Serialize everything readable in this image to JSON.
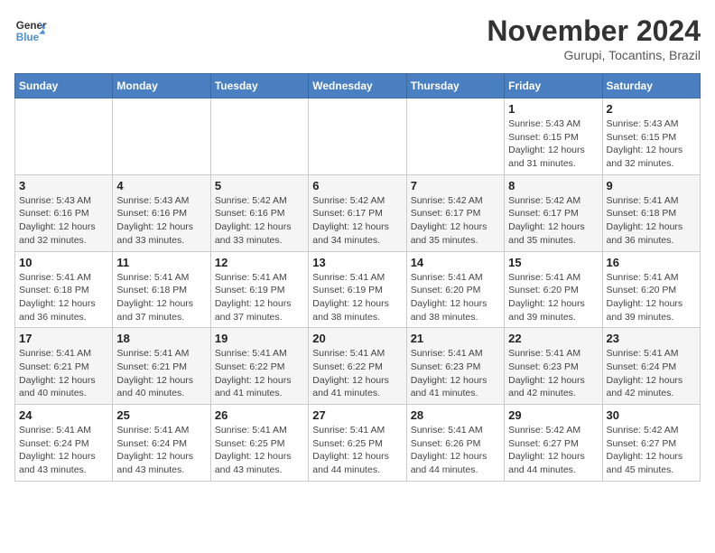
{
  "header": {
    "logo_line1": "General",
    "logo_line2": "Blue",
    "month": "November 2024",
    "location": "Gurupi, Tocantins, Brazil"
  },
  "weekdays": [
    "Sunday",
    "Monday",
    "Tuesday",
    "Wednesday",
    "Thursday",
    "Friday",
    "Saturday"
  ],
  "weeks": [
    [
      {
        "day": "",
        "info": ""
      },
      {
        "day": "",
        "info": ""
      },
      {
        "day": "",
        "info": ""
      },
      {
        "day": "",
        "info": ""
      },
      {
        "day": "",
        "info": ""
      },
      {
        "day": "1",
        "info": "Sunrise: 5:43 AM\nSunset: 6:15 PM\nDaylight: 12 hours and 31 minutes."
      },
      {
        "day": "2",
        "info": "Sunrise: 5:43 AM\nSunset: 6:15 PM\nDaylight: 12 hours and 32 minutes."
      }
    ],
    [
      {
        "day": "3",
        "info": "Sunrise: 5:43 AM\nSunset: 6:16 PM\nDaylight: 12 hours and 32 minutes."
      },
      {
        "day": "4",
        "info": "Sunrise: 5:43 AM\nSunset: 6:16 PM\nDaylight: 12 hours and 33 minutes."
      },
      {
        "day": "5",
        "info": "Sunrise: 5:42 AM\nSunset: 6:16 PM\nDaylight: 12 hours and 33 minutes."
      },
      {
        "day": "6",
        "info": "Sunrise: 5:42 AM\nSunset: 6:17 PM\nDaylight: 12 hours and 34 minutes."
      },
      {
        "day": "7",
        "info": "Sunrise: 5:42 AM\nSunset: 6:17 PM\nDaylight: 12 hours and 35 minutes."
      },
      {
        "day": "8",
        "info": "Sunrise: 5:42 AM\nSunset: 6:17 PM\nDaylight: 12 hours and 35 minutes."
      },
      {
        "day": "9",
        "info": "Sunrise: 5:41 AM\nSunset: 6:18 PM\nDaylight: 12 hours and 36 minutes."
      }
    ],
    [
      {
        "day": "10",
        "info": "Sunrise: 5:41 AM\nSunset: 6:18 PM\nDaylight: 12 hours and 36 minutes."
      },
      {
        "day": "11",
        "info": "Sunrise: 5:41 AM\nSunset: 6:18 PM\nDaylight: 12 hours and 37 minutes."
      },
      {
        "day": "12",
        "info": "Sunrise: 5:41 AM\nSunset: 6:19 PM\nDaylight: 12 hours and 37 minutes."
      },
      {
        "day": "13",
        "info": "Sunrise: 5:41 AM\nSunset: 6:19 PM\nDaylight: 12 hours and 38 minutes."
      },
      {
        "day": "14",
        "info": "Sunrise: 5:41 AM\nSunset: 6:20 PM\nDaylight: 12 hours and 38 minutes."
      },
      {
        "day": "15",
        "info": "Sunrise: 5:41 AM\nSunset: 6:20 PM\nDaylight: 12 hours and 39 minutes."
      },
      {
        "day": "16",
        "info": "Sunrise: 5:41 AM\nSunset: 6:20 PM\nDaylight: 12 hours and 39 minutes."
      }
    ],
    [
      {
        "day": "17",
        "info": "Sunrise: 5:41 AM\nSunset: 6:21 PM\nDaylight: 12 hours and 40 minutes."
      },
      {
        "day": "18",
        "info": "Sunrise: 5:41 AM\nSunset: 6:21 PM\nDaylight: 12 hours and 40 minutes."
      },
      {
        "day": "19",
        "info": "Sunrise: 5:41 AM\nSunset: 6:22 PM\nDaylight: 12 hours and 41 minutes."
      },
      {
        "day": "20",
        "info": "Sunrise: 5:41 AM\nSunset: 6:22 PM\nDaylight: 12 hours and 41 minutes."
      },
      {
        "day": "21",
        "info": "Sunrise: 5:41 AM\nSunset: 6:23 PM\nDaylight: 12 hours and 41 minutes."
      },
      {
        "day": "22",
        "info": "Sunrise: 5:41 AM\nSunset: 6:23 PM\nDaylight: 12 hours and 42 minutes."
      },
      {
        "day": "23",
        "info": "Sunrise: 5:41 AM\nSunset: 6:24 PM\nDaylight: 12 hours and 42 minutes."
      }
    ],
    [
      {
        "day": "24",
        "info": "Sunrise: 5:41 AM\nSunset: 6:24 PM\nDaylight: 12 hours and 43 minutes."
      },
      {
        "day": "25",
        "info": "Sunrise: 5:41 AM\nSunset: 6:24 PM\nDaylight: 12 hours and 43 minutes."
      },
      {
        "day": "26",
        "info": "Sunrise: 5:41 AM\nSunset: 6:25 PM\nDaylight: 12 hours and 43 minutes."
      },
      {
        "day": "27",
        "info": "Sunrise: 5:41 AM\nSunset: 6:25 PM\nDaylight: 12 hours and 44 minutes."
      },
      {
        "day": "28",
        "info": "Sunrise: 5:41 AM\nSunset: 6:26 PM\nDaylight: 12 hours and 44 minutes."
      },
      {
        "day": "29",
        "info": "Sunrise: 5:42 AM\nSunset: 6:27 PM\nDaylight: 12 hours and 44 minutes."
      },
      {
        "day": "30",
        "info": "Sunrise: 5:42 AM\nSunset: 6:27 PM\nDaylight: 12 hours and 45 minutes."
      }
    ]
  ]
}
